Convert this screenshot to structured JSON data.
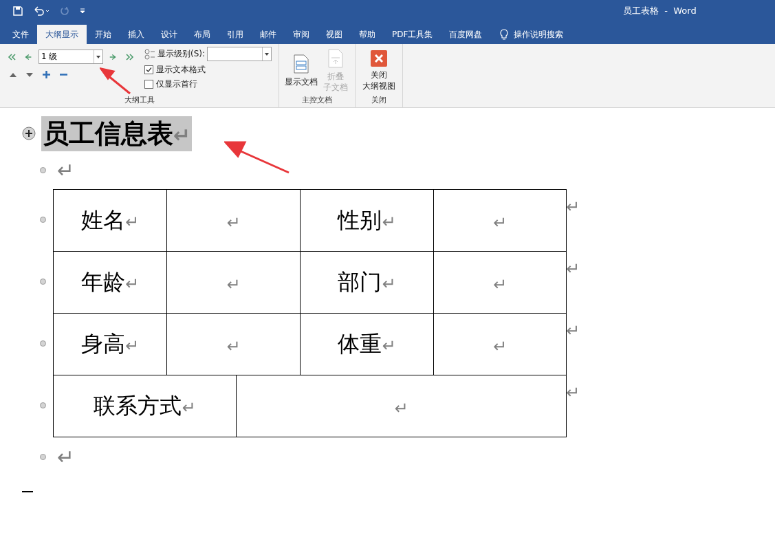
{
  "window": {
    "title": "员工表格  -  Word"
  },
  "tabs": [
    {
      "label": "文件",
      "selected": false
    },
    {
      "label": "大纲显示",
      "selected": true
    },
    {
      "label": "开始",
      "selected": false
    },
    {
      "label": "插入",
      "selected": false
    },
    {
      "label": "设计",
      "selected": false
    },
    {
      "label": "布局",
      "selected": false
    },
    {
      "label": "引用",
      "selected": false
    },
    {
      "label": "邮件",
      "selected": false
    },
    {
      "label": "审阅",
      "selected": false
    },
    {
      "label": "视图",
      "selected": false
    },
    {
      "label": "帮助",
      "selected": false
    },
    {
      "label": "PDF工具集",
      "selected": false
    },
    {
      "label": "百度网盘",
      "selected": false
    }
  ],
  "tell_me": "操作说明搜索",
  "outline_tools": {
    "level_value": "1 级",
    "show_level_label": "显示级别(S):",
    "options": [
      {
        "label": "显示文本格式",
        "checked": true
      },
      {
        "label": "仅显示首行",
        "checked": false
      }
    ],
    "group_label": "大纲工具"
  },
  "master_document": {
    "buttons": [
      {
        "label": [
          "显示文档"
        ],
        "disabled": false
      },
      {
        "label": [
          "折叠",
          "子文档"
        ],
        "disabled": true
      }
    ],
    "group_label": "主控文档"
  },
  "close": {
    "button": [
      "关闭",
      "大纲视图"
    ],
    "group_label": "关闭"
  },
  "document": {
    "heading": {
      "text": "员工信息表",
      "mark": "↵",
      "selected": true
    },
    "empty_mark": "↵",
    "table": [
      {
        "cells": [
          "姓名",
          "",
          "性别",
          ""
        ],
        "end": "↵"
      },
      {
        "cells": [
          "年龄",
          "",
          "部门",
          ""
        ],
        "end": "↵"
      },
      {
        "cells": [
          "身高",
          "",
          "体重",
          ""
        ],
        "end": "↵"
      },
      {
        "cells": [
          "联系方式",
          ""
        ],
        "end": "↵"
      }
    ],
    "cell_mark": "↵",
    "trailing_mark": "↵"
  }
}
